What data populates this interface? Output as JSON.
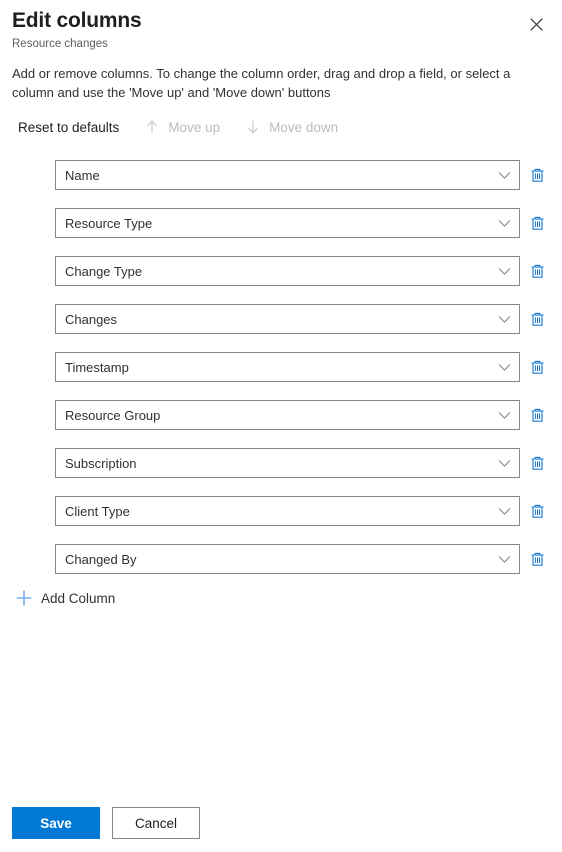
{
  "panel": {
    "title": "Edit columns",
    "subtitle": "Resource changes",
    "description": "Add or remove columns. To change the column order, drag and drop a field, or select a column and use the 'Move up' and 'Move down' buttons",
    "close_icon": "close-icon"
  },
  "commandbar": {
    "reset_label": "Reset to defaults",
    "move_up_label": "Move up",
    "move_down_label": "Move down",
    "move_up_icon": "arrow-up-icon",
    "move_down_icon": "arrow-down-icon",
    "move_up_enabled": false,
    "move_down_enabled": false
  },
  "columns": [
    {
      "label": "Name"
    },
    {
      "label": "Resource Type"
    },
    {
      "label": "Change Type"
    },
    {
      "label": "Changes"
    },
    {
      "label": "Timestamp"
    },
    {
      "label": "Resource Group"
    },
    {
      "label": "Subscription"
    },
    {
      "label": "Client Type"
    },
    {
      "label": "Changed By"
    }
  ],
  "add_column": {
    "label": "Add Column",
    "icon": "plus-icon"
  },
  "footer": {
    "save_label": "Save",
    "cancel_label": "Cancel"
  },
  "colors": {
    "accent": "#0078d4",
    "delete_icon": "#1b79d6",
    "plus_icon": "#7aaee8",
    "border": "#8a8886",
    "disabled_text": "#bcbcbc",
    "subtitle_text": "#605e5c"
  }
}
